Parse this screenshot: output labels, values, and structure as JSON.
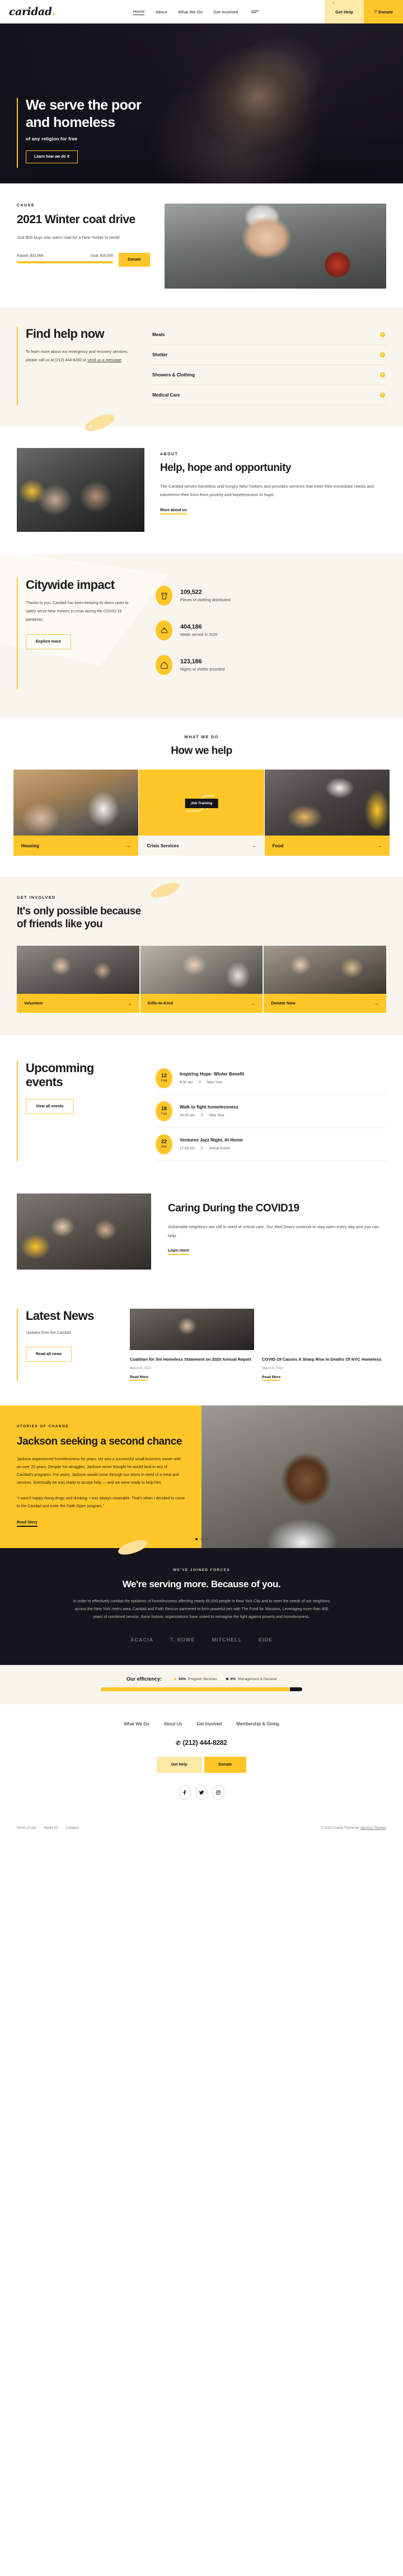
{
  "header": {
    "logo": "caridad",
    "nav": [
      {
        "label": "Home",
        "active": true
      },
      {
        "label": "About",
        "active": false
      },
      {
        "label": "What We Do",
        "active": false
      },
      {
        "label": "Get Involved",
        "active": false
      }
    ],
    "get_help": "Get Help",
    "donate": "Donate"
  },
  "hero": {
    "title_line1": "We serve the poor",
    "title_line2": "and homeless",
    "subtitle": "of any religion for free",
    "cta": "Learn how we do it"
  },
  "cause": {
    "eyebrow": "CAUSE",
    "title": "2021 Winter coat drive",
    "body": "Just $50 buys one warm coat for a New Yorker in need!",
    "raised_label": "Raised: $32,969",
    "goal_label": "Goal: $20,000",
    "donate": "Donate"
  },
  "find_help": {
    "title": "Find help now",
    "body": "To learn more about our emergency and recovery services, please call us at (212) 444-8282 or send us a message.",
    "link_text": "send us a message",
    "phone": "(212) 444-8282",
    "items": [
      {
        "label": "Meals"
      },
      {
        "label": "Shelter"
      },
      {
        "label": "Showers & Clothing"
      },
      {
        "label": "Medical Care"
      }
    ]
  },
  "about": {
    "eyebrow": "ABOUT",
    "title": "Help, hope and opportunity",
    "body": "The Caridad serves homeless and hungry New Yorkers and provides services that meet their immediate needs and transforms their lives from poverty and hopelessness to hope.",
    "link": "More about us"
  },
  "impact": {
    "title": "Citywide impact",
    "body": "Thanks to you, Caridad has been keeping its doors open to safely serve New Yorkers in crisis during the COVID-19 pandemic.",
    "cta": "Explore more",
    "stats": [
      {
        "icon": "tshirt-icon",
        "value": "109,522",
        "label": "Pieces of clothing distributed"
      },
      {
        "icon": "meal-dome-icon",
        "value": "404,186",
        "label": "Meals served in 2020"
      },
      {
        "icon": "home-icon",
        "value": "123,186",
        "label": "Nights of shelter provided"
      }
    ]
  },
  "how_we_help": {
    "eyebrow": "WHAT WE DO",
    "title": "How we help",
    "badge": "Job Training",
    "cards": [
      {
        "label": "Housing"
      },
      {
        "label": "Crisis Services"
      },
      {
        "label": "Food"
      }
    ]
  },
  "get_involved": {
    "eyebrow": "GET INVOLVED",
    "title_line1": "It's only possible because",
    "title_line2": "of friends like you",
    "cards": [
      {
        "label": "Volunteer"
      },
      {
        "label": "Gifts-In-Kind"
      },
      {
        "label": "Donate Now"
      }
    ]
  },
  "events": {
    "title": "Upcomming events",
    "cta": "View all events",
    "items": [
      {
        "day": "12",
        "month": "Feb",
        "title": "Inspiring Hope: Winter Benefit",
        "time": "8:00 am",
        "place": "New York"
      },
      {
        "day": "18",
        "month": "Feb",
        "title": "Walk to fight homelessness",
        "time": "10:00 am",
        "place": "New York"
      },
      {
        "day": "22",
        "month": "Mar",
        "title": "Ventures Jazz Night, At Home",
        "time": "17:30 pm",
        "place": "Virtual Event"
      }
    ]
  },
  "covid": {
    "title": "Caring During the COVID19",
    "body": "Vulnerable neighbors are still in need of critical care. Our Red Doors continue to stay open every day and you can help.",
    "link": "Learn more"
  },
  "news": {
    "title": "Latest News",
    "subtitle": "Updates from the Caridad",
    "cta": "Read all news",
    "cards": [
      {
        "title": "Coalition for the Homeless Statement on 2020 Annual Report",
        "date": "March 8, 2021",
        "more": "Read More"
      },
      {
        "title": "COVID-19 Causes A Sharp Rise In Deaths Of NYC Homeless",
        "date": "March 8, 2021",
        "more": "Read More"
      }
    ]
  },
  "story": {
    "eyebrow": "STORIES OF CHANGE",
    "title": "Jackson seeking a second chance",
    "body": "Jackson experienced homelessness for years. He was a successful small-business owner with an over 20 years. Despite his struggles, Jackson never thought he would land in any of Caridad's programs. For years, Jackson would come through our doors in need of a meal and services. Eventually he was ready to accept help — and we were ready to help him.",
    "body2": "\"I wasn't happy doing drugs and drinking. I was always miserable. That's when I decided to come to the Caridad and enter the Faith Open program.\"",
    "cta": "Read Story"
  },
  "partners": {
    "eyebrow": "WE'VE JOINED FORCES",
    "title": "We're serving more. Because of you.",
    "body": "In order to effectively combat the epidemic of homelessness affecting nearly 80,000 people in New York City and to meet the needs of our neighbors across the New York metro area, Caridad and Faith Rescue partnered to form powerful ties with The Fund for Missions, Leveraging more than 400 years of combined service, these historic organizations have united to reimagine the fight against poverty and homelessness.",
    "logos": [
      "ACACIA",
      "T. ROWE",
      "MITCHELL",
      "EIDE"
    ]
  },
  "efficiency": {
    "title": "Our efficiency:",
    "legend": [
      {
        "pct": "94%",
        "label": "Program Services",
        "color": "#FFC629"
      },
      {
        "pct": "6%",
        "label": "Management & General",
        "color": "#16161a"
      }
    ],
    "program_pct": 94,
    "mgmt_pct": 6
  },
  "footer": {
    "nav": [
      "What We Do",
      "About Us",
      "Get Involved",
      "Membership & Giving"
    ],
    "phone": "(212) 444-8282",
    "get_help": "Get Help",
    "donate": "Donate",
    "socials": [
      "facebook-icon",
      "twitter-icon",
      "instagram-icon"
    ],
    "legal_links": [
      "Terms of use",
      "Media Kit",
      "Contacts"
    ],
    "copyright": "© 2022 Charity Theme by ",
    "copyright_link": "YamYam Themes"
  }
}
